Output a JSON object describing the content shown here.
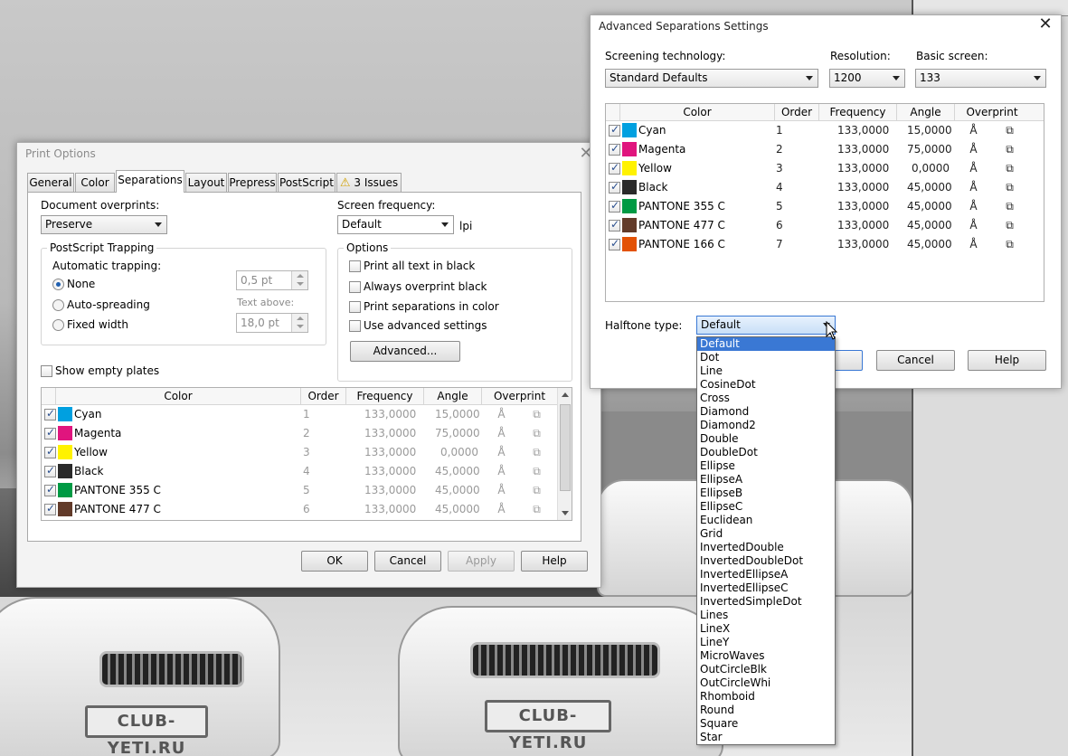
{
  "background": {
    "plate_left": "CLUB-YETI.RU",
    "plate_right": "CLUB-YETI.RU"
  },
  "print_options": {
    "title": "Print Options",
    "tabs": [
      "General",
      "Color",
      "Separations",
      "Layout",
      "Prepress",
      "PostScript",
      "3 Issues"
    ],
    "active_tab": "Separations",
    "document_overprints_label": "Document overprints:",
    "document_overprints_value": "Preserve",
    "screen_frequency_label": "Screen frequency:",
    "screen_frequency_value": "Default",
    "screen_frequency_unit": "lpi",
    "trapping": {
      "group_label": "PostScript Trapping",
      "automatic_label": "Automatic trapping:",
      "options": [
        "None",
        "Auto-spreading",
        "Fixed width"
      ],
      "selected": "None",
      "width_value": "0,5 pt",
      "text_above_label": "Text above:",
      "text_above_value": "18,0 pt"
    },
    "options_group": {
      "label": "Options",
      "checkboxes": [
        {
          "label": "Print all text in black",
          "checked": false
        },
        {
          "label": "Always overprint black",
          "checked": false
        },
        {
          "label": "Print separations in color",
          "checked": false
        },
        {
          "label": "Use advanced settings",
          "checked": false
        }
      ],
      "advanced_button": "Advanced..."
    },
    "show_empty_plates_label": "Show empty plates",
    "table": {
      "headers": [
        "Color",
        "Order",
        "Frequency",
        "Angle",
        "Overprint"
      ],
      "rows": [
        {
          "color": "Cyan",
          "swatch": "#00a0e0",
          "order": "1",
          "frequency": "133,0000",
          "angle": "15,0000"
        },
        {
          "color": "Magenta",
          "swatch": "#e0157e",
          "order": "2",
          "frequency": "133,0000",
          "angle": "75,0000"
        },
        {
          "color": "Yellow",
          "swatch": "#fff200",
          "order": "3",
          "frequency": "133,0000",
          "angle": "0,0000"
        },
        {
          "color": "Black",
          "swatch": "#2a2a2a",
          "order": "4",
          "frequency": "133,0000",
          "angle": "45,0000"
        },
        {
          "color": "PANTONE 355 C",
          "swatch": "#009a44",
          "order": "5",
          "frequency": "133,0000",
          "angle": "45,0000"
        },
        {
          "color": "PANTONE 477 C",
          "swatch": "#623b2a",
          "order": "6",
          "frequency": "133,0000",
          "angle": "45,0000"
        }
      ]
    },
    "buttons": {
      "ok": "OK",
      "cancel": "Cancel",
      "apply": "Apply",
      "help": "Help"
    }
  },
  "advanced": {
    "title": "Advanced Separations Settings",
    "screening_label": "Screening technology:",
    "screening_value": "Standard Defaults",
    "resolution_label": "Resolution:",
    "resolution_value": "1200",
    "basic_screen_label": "Basic screen:",
    "basic_screen_value": "133",
    "table": {
      "headers": [
        "Color",
        "Order",
        "Frequency",
        "Angle",
        "Overprint"
      ],
      "rows": [
        {
          "color": "Cyan",
          "swatch": "#00a0e0",
          "order": "1",
          "frequency": "133,0000",
          "angle": "15,0000"
        },
        {
          "color": "Magenta",
          "swatch": "#e0157e",
          "order": "2",
          "frequency": "133,0000",
          "angle": "75,0000"
        },
        {
          "color": "Yellow",
          "swatch": "#fff200",
          "order": "3",
          "frequency": "133,0000",
          "angle": "0,0000"
        },
        {
          "color": "Black",
          "swatch": "#2a2a2a",
          "order": "4",
          "frequency": "133,0000",
          "angle": "45,0000"
        },
        {
          "color": "PANTONE 355 C",
          "swatch": "#009a44",
          "order": "5",
          "frequency": "133,0000",
          "angle": "45,0000"
        },
        {
          "color": "PANTONE 477 C",
          "swatch": "#623b2a",
          "order": "6",
          "frequency": "133,0000",
          "angle": "45,0000"
        },
        {
          "color": "PANTONE 166 C",
          "swatch": "#e35205",
          "order": "7",
          "frequency": "133,0000",
          "angle": "45,0000"
        }
      ]
    },
    "halftone_label": "Halftone type:",
    "halftone_value": "Default",
    "buttons": {
      "cancel": "Cancel",
      "help": "Help"
    },
    "halftone_options": [
      "Default",
      "Dot",
      "Line",
      "CosineDot",
      "Cross",
      "Diamond",
      "Diamond2",
      "Double",
      "DoubleDot",
      "Ellipse",
      "EllipseA",
      "EllipseB",
      "EllipseC",
      "Euclidean",
      "Grid",
      "InvertedDouble",
      "InvertedDoubleDot",
      "InvertedEllipseA",
      "InvertedEllipseC",
      "InvertedSimpleDot",
      "Lines",
      "LineX",
      "LineY",
      "MicroWaves",
      "OutCircleBlk",
      "OutCircleWhi",
      "Rhomboid",
      "Round",
      "Square",
      "Star"
    ]
  }
}
